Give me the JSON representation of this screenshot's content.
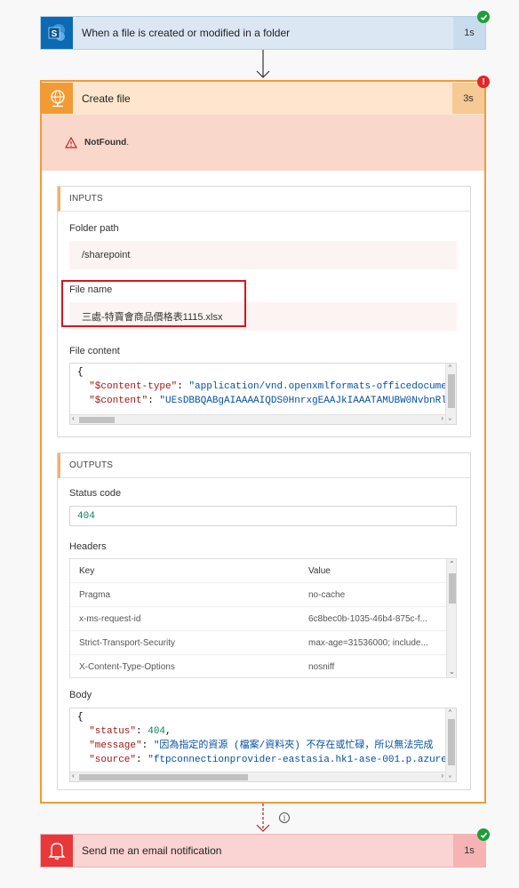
{
  "trigger": {
    "title": "When a file is created or modified in a folder",
    "duration": "1s",
    "icon": "sharepoint-icon",
    "status": "succeeded"
  },
  "action": {
    "title": "Create file",
    "duration": "3s",
    "icon": "globe-server-icon",
    "status": "failed",
    "error": "NotFound",
    "error_suffix": "."
  },
  "inputs": {
    "header": "INPUTS",
    "folder_path_label": "Folder path",
    "folder_path": "/sharepoint",
    "file_name_label": "File name",
    "file_name": "三處-特賣會商品價格表1115.xlsx",
    "file_content_label": "File content",
    "file_content_lines": [
      {
        "brace": "{"
      },
      {
        "key": "\"$content-type\"",
        "value": "\"application/vnd.openxmlformats-officedocument"
      },
      {
        "key": "\"$content\"",
        "value": "\"UEsDBBQABgAIAAAAIQDS0HnrxgEAAJkIAAATAMUBW0NvbnRlbn"
      }
    ]
  },
  "outputs": {
    "header": "OUTPUTS",
    "status_code_label": "Status code",
    "status_code": "404",
    "headers_label": "Headers",
    "headers_columns": {
      "key": "Key",
      "value": "Value"
    },
    "headers_rows": [
      {
        "key": "Pragma",
        "value": "no-cache"
      },
      {
        "key": "x-ms-request-id",
        "value": "6c8bec0b-1035-46b4-875c-f..."
      },
      {
        "key": "Strict-Transport-Security",
        "value": "max-age=31536000; include..."
      },
      {
        "key": "X-Content-Type-Options",
        "value": "nosniff"
      }
    ],
    "body_label": "Body",
    "body_lines": [
      {
        "brace": "{"
      },
      {
        "key": "\"status\"",
        "value": "404",
        "trail": ","
      },
      {
        "key": "\"message\"",
        "value": "\"因為指定的資源 (檔案/資料夾) 不存在或忙碌，所以無法完成",
        "trail": ""
      },
      {
        "key": "\"source\"",
        "value": "\"ftpconnectionprovider-eastasia.hk1-ase-001.p.azurewe",
        "trail": ""
      }
    ]
  },
  "next_step": {
    "title": "Send me an email notification",
    "duration": "1s",
    "icon": "bell-icon",
    "status": "succeeded"
  },
  "colors": {
    "trigger_bg": "#dbe8f3",
    "action_border": "#f39a38",
    "error_bg": "#fad7cb",
    "email_bg": "#fad3d3",
    "success": "#1e9e3a",
    "failure": "#e0282b"
  }
}
